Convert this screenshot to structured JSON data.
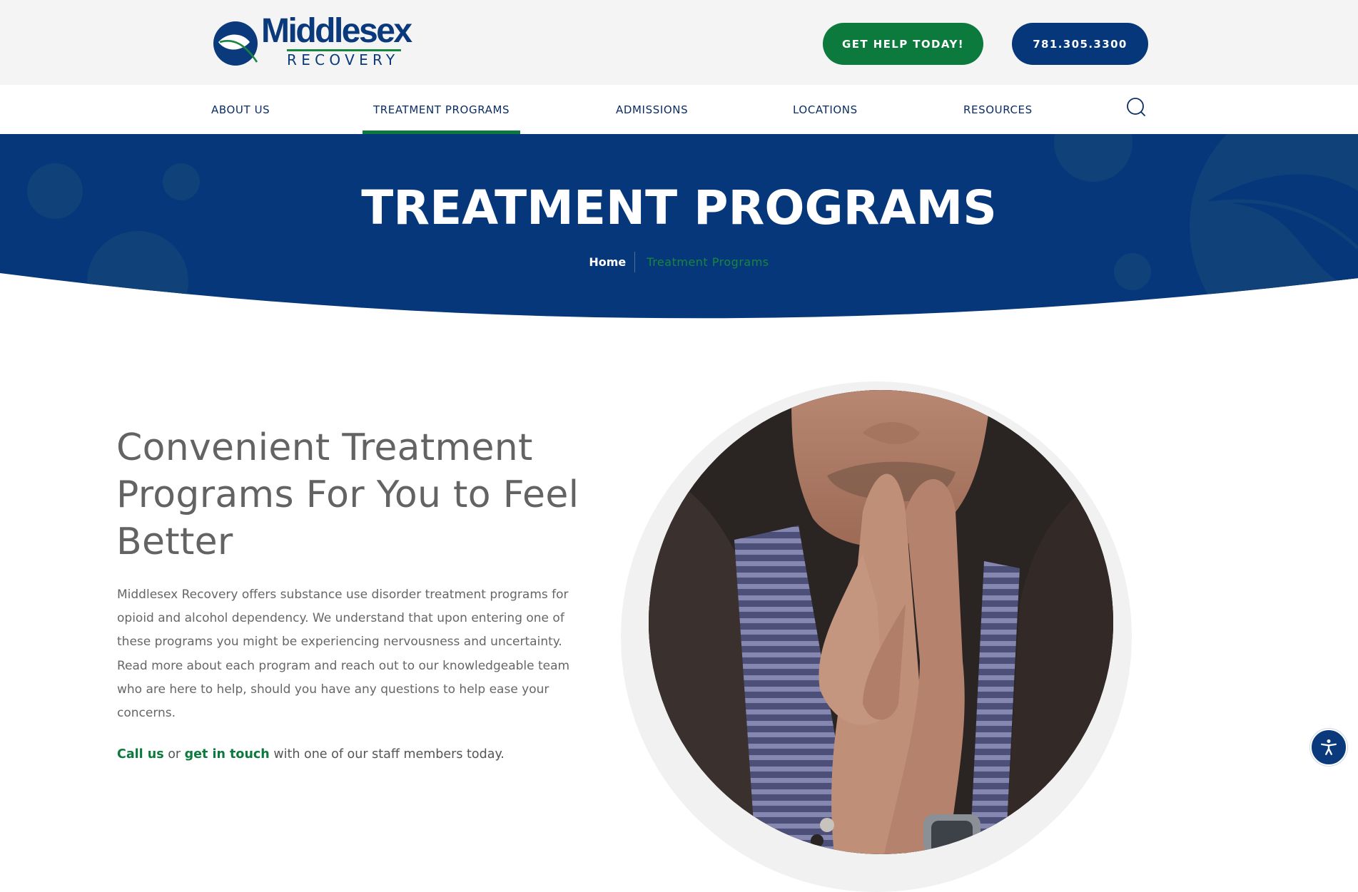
{
  "brand": {
    "name": "Middlesex",
    "subname": "RECOVERY",
    "logo_icon": "leaf-circle-icon",
    "colors": {
      "navy": "#05377a",
      "green": "#0c7a3c",
      "text_gray": "#666666",
      "header_bg": "#f4f4f4"
    }
  },
  "header": {
    "cta_label": "GET HELP TODAY!",
    "phone_label": "781.305.3300"
  },
  "nav": {
    "items": [
      {
        "label": "ABOUT US",
        "active": false
      },
      {
        "label": "TREATMENT PROGRAMS",
        "active": true
      },
      {
        "label": "ADMISSIONS",
        "active": false
      },
      {
        "label": "LOCATIONS",
        "active": false
      },
      {
        "label": "RESOURCES",
        "active": false
      }
    ],
    "search_icon": "search-icon"
  },
  "banner": {
    "title": "TREATMENT PROGRAMS",
    "breadcrumb": [
      {
        "label": "Home"
      },
      {
        "label": "Treatment Programs"
      }
    ]
  },
  "intro": {
    "heading": "Convenient Treatment Programs For You to Feel Better",
    "body": "Middlesex Recovery offers substance use disorder treatment programs for opioid and alcohol dependency. We understand that upon entering one of these programs you might be experiencing nervousness and uncertainty. Read more about each program and reach out to our knowledgeable team who are here to help, should you have any questions to help ease your concerns.",
    "cta": {
      "call_link": "Call us",
      "or_text": " or ",
      "touch_link": "get in touch",
      "rest_text": " with one of our staff members today."
    },
    "image_alt": "Man with hands pressed together in front of his mouth"
  },
  "accessibility": {
    "icon": "accessibility-icon"
  }
}
